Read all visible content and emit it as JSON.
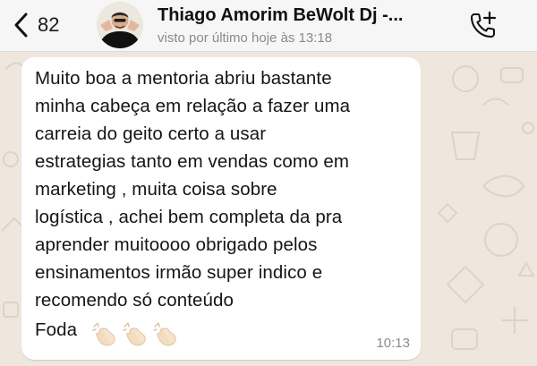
{
  "header": {
    "back_count": "82",
    "contact_name": "Thiago Amorim BeWolt Dj -...",
    "last_seen": "visto por último hoje às 13:18"
  },
  "icons": {
    "back": "chevron-left-icon",
    "call": "add-call-icon",
    "clap": "clapping-hands-emoji"
  },
  "message": {
    "lines": [
      "Muito boa a mentoria abriu bastante",
      "minha cabeça em relação a fazer uma",
      "carreia do geito certo a usar",
      "estrategias tanto em vendas como em",
      "marketing , muita coisa sobre",
      "logística , achei bem completa da pra",
      "aprender muitoooo obrigado pelos",
      "ensinamentos irmão super indico e",
      "recomendo só conteúdo",
      "Foda"
    ],
    "time": "10:13"
  },
  "colors": {
    "chat_background": "#efe7de",
    "bubble": "#ffffff",
    "header": "#f6f6f6"
  }
}
